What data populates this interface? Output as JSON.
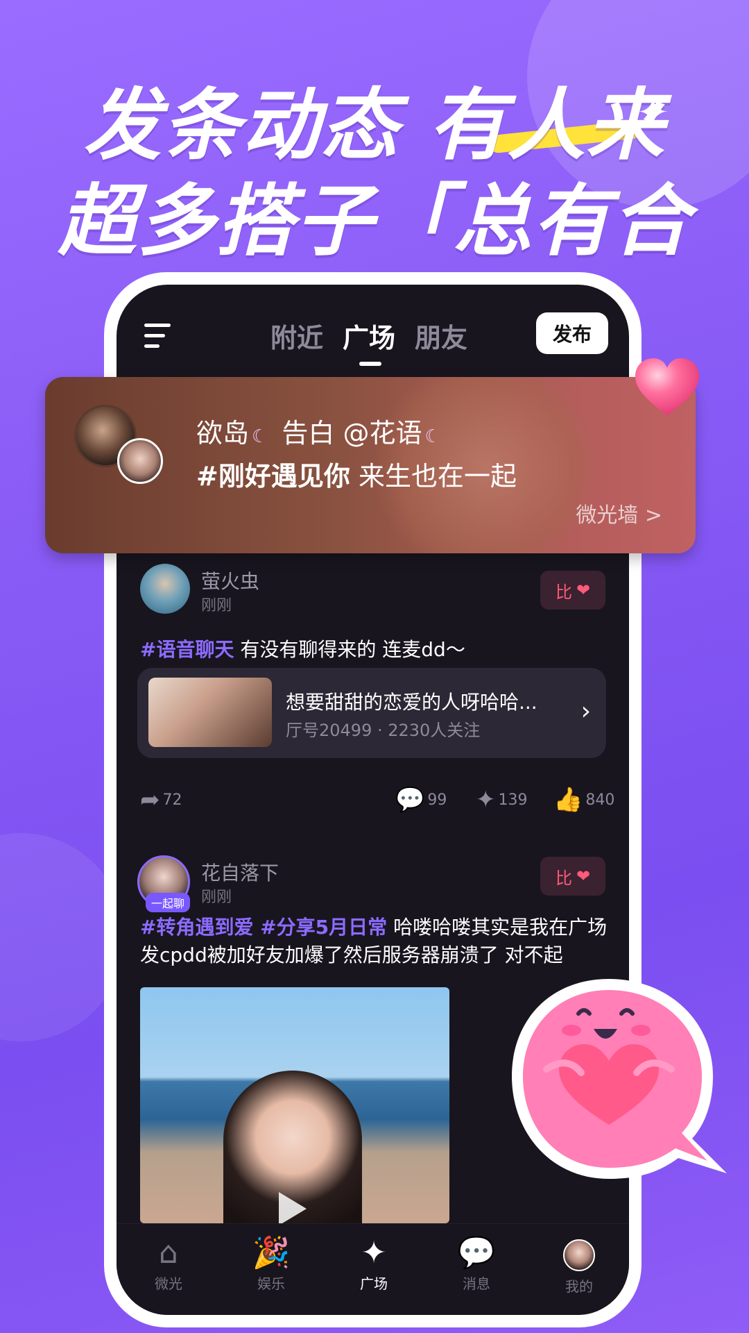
{
  "promo": {
    "headline_line1": "发条动态 有人来",
    "headline_line2": "超多搭子「总有合拍」"
  },
  "topbar": {
    "tabs": [
      "附近",
      "广场",
      "朋友"
    ],
    "active_tab": "广场",
    "publish_label": "发布"
  },
  "banner": {
    "user_from": "欲岛",
    "action": "告白",
    "user_to": "@花语",
    "hashtag": "#刚好遇见你",
    "message": "来生也在一起",
    "link_label": "微光墙 >"
  },
  "posts": [
    {
      "name": "萤火虫",
      "time": "刚刚",
      "compare_label": "比",
      "hashtag": "#语音聊天",
      "text": "有没有聊得来的 连麦dd～",
      "room": {
        "title": "想要甜甜的恋爱的人呀哈哈...",
        "subtitle": "厅号20499 · 2230人关注"
      },
      "shares": "72",
      "comments": "99",
      "sparks": "139",
      "likes": "840"
    },
    {
      "name": "花自落下",
      "time": "刚刚",
      "badge": "一起聊",
      "compare_label": "比",
      "hashtags": "#转角遇到爱 #分享5月日常",
      "text": "哈喽哈喽其实是我在广场发cpdd被加好友加爆了然后服务器崩溃了 对不起"
    }
  ],
  "tabbar": {
    "items": [
      "微光",
      "娱乐",
      "广场",
      "消息",
      "我的"
    ],
    "active": "广场"
  },
  "colors": {
    "background": "#8a5cf6",
    "screen": "#18151f",
    "hashtag": "#8c6bff",
    "heart": "#ff5a7a"
  }
}
